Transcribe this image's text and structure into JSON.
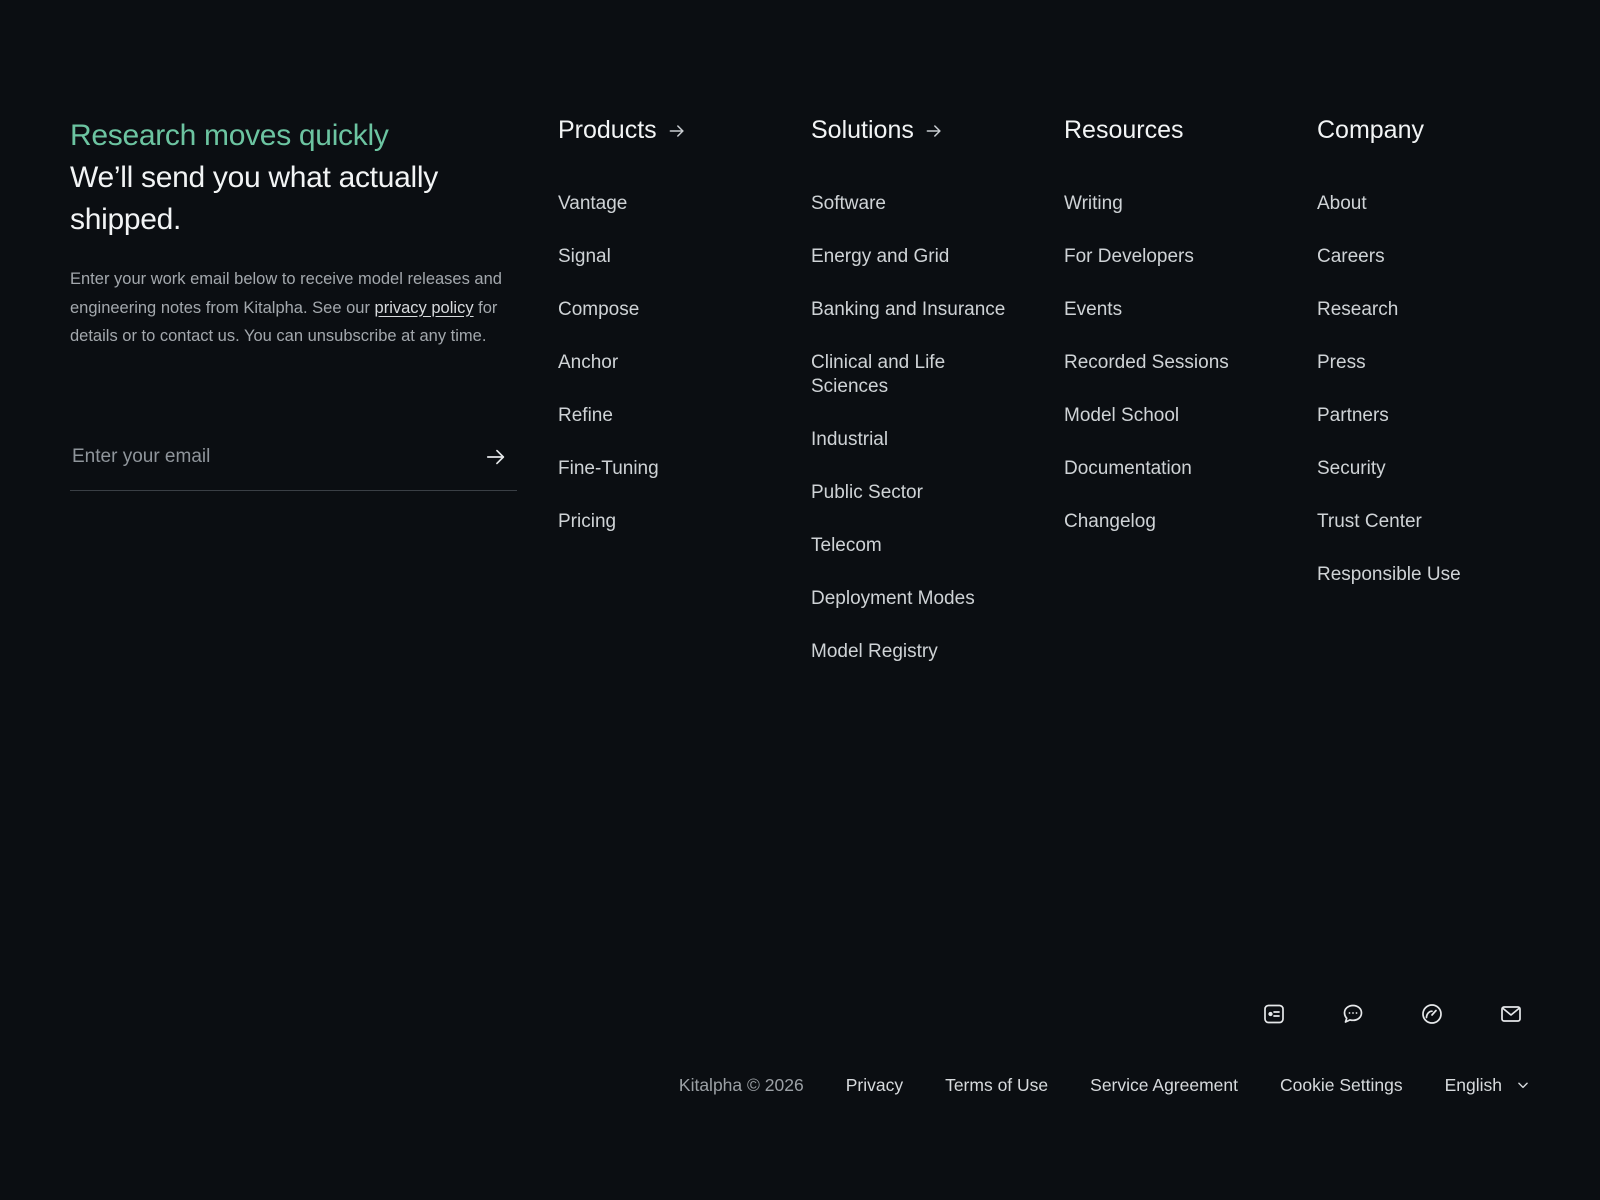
{
  "newsletter": {
    "accent": "Research moves quickly",
    "headline": "We’ll send you what actually shipped.",
    "body_pre": "Enter your work email below to receive model releases and engineering notes from Kitalpha. See our ",
    "privacy_link": "privacy policy",
    "body_post": " for details or to contact us. You can unsubscribe at any time.",
    "email_placeholder": "Enter your email",
    "submit_icon": "arrow-right-icon"
  },
  "columns": {
    "products": {
      "title": "Products",
      "has_arrow": true,
      "items": [
        "Vantage",
        "Signal",
        "Compose",
        "Anchor",
        "Refine",
        "Fine-Tuning",
        "Pricing"
      ]
    },
    "solutions": {
      "title": "Solutions",
      "has_arrow": true,
      "items": [
        "Software",
        "Energy and Grid",
        "Banking and Insurance",
        "Clinical and Life Sciences",
        "Industrial",
        "Public Sector",
        "Telecom",
        "Deployment Modes",
        "Model Registry"
      ]
    },
    "resources": {
      "title": "Resources",
      "has_arrow": false,
      "items": [
        "Writing",
        "For Developers",
        "Events",
        "Recorded Sessions",
        "Model School",
        "Documentation",
        "Changelog"
      ]
    },
    "company": {
      "title": "Company",
      "has_arrow": false,
      "items": [
        "About",
        "Careers",
        "Research",
        "Press",
        "Partners",
        "Security",
        "Trust Center",
        "Responsible Use"
      ]
    }
  },
  "socials": [
    "id-card-icon",
    "chat-bubble-icon",
    "gauge-icon",
    "mail-icon"
  ],
  "bottom": {
    "copyright": "Kitalpha © 2026",
    "links": [
      "Privacy",
      "Terms of Use",
      "Service Agreement",
      "Cookie Settings"
    ],
    "language": "English"
  },
  "colors": {
    "background": "#0b0e12",
    "accent": "#6cc4a1",
    "heading": "#f2f4f5",
    "link": "#cfd3d6",
    "muted": "#a3a8ad"
  }
}
